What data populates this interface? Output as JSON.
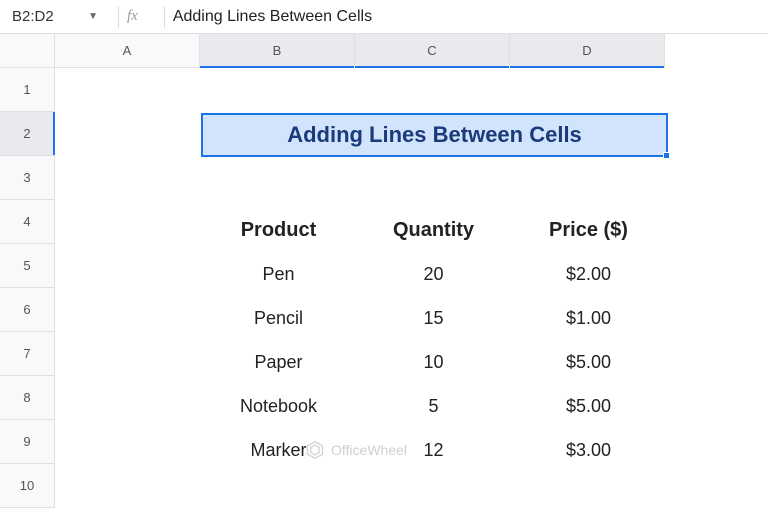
{
  "formulaBar": {
    "nameBox": "B2:D2",
    "formula": "Adding Lines Between Cells"
  },
  "columns": [
    "A",
    "B",
    "C",
    "D"
  ],
  "rows": [
    "1",
    "2",
    "3",
    "4",
    "5",
    "6",
    "7",
    "8",
    "9",
    "10"
  ],
  "selection": {
    "title": "Adding Lines Between Cells"
  },
  "table": {
    "headers": {
      "product": "Product",
      "quantity": "Quantity",
      "price": "Price ($)"
    },
    "rows": [
      {
        "product": "Pen",
        "quantity": "20",
        "price": "$2.00"
      },
      {
        "product": "Pencil",
        "quantity": "15",
        "price": "$1.00"
      },
      {
        "product": "Paper",
        "quantity": "10",
        "price": "$5.00"
      },
      {
        "product": "Notebook",
        "quantity": "5",
        "price": "$5.00"
      },
      {
        "product": "Marker",
        "quantity": "12",
        "price": "$3.00"
      }
    ]
  },
  "watermark": "OfficeWheel",
  "colWidths": {
    "A": 145,
    "B": 155,
    "C": 155,
    "D": 155
  },
  "selectedCols": [
    "B",
    "C",
    "D"
  ],
  "selectedRow": "2"
}
